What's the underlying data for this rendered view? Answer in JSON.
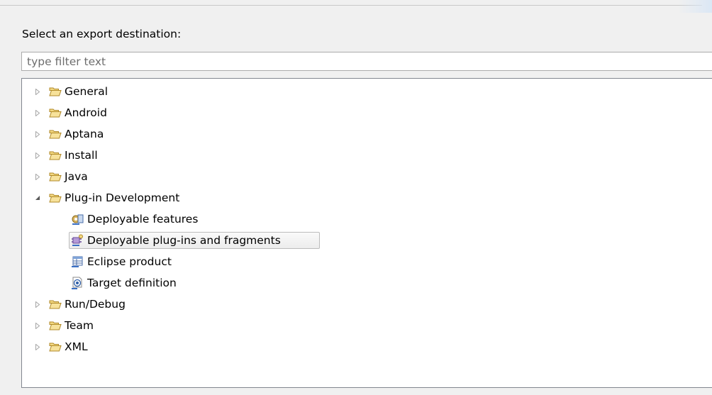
{
  "prompt_label": "Select an export destination:",
  "filter": {
    "value": "",
    "placeholder": "type filter text"
  },
  "tree": {
    "items": [
      {
        "label": "General",
        "icon": "folder-icon",
        "expanded": false
      },
      {
        "label": "Android",
        "icon": "folder-icon",
        "expanded": false
      },
      {
        "label": "Aptana",
        "icon": "folder-icon",
        "expanded": false
      },
      {
        "label": "Install",
        "icon": "folder-icon",
        "expanded": false
      },
      {
        "label": "Java",
        "icon": "folder-icon",
        "expanded": false
      },
      {
        "label": "Plug-in Development",
        "icon": "folder-icon",
        "expanded": true,
        "children": [
          {
            "label": "Deployable features",
            "icon": "feature-export-icon"
          },
          {
            "label": "Deployable plug-ins and fragments",
            "icon": "plugin-export-icon",
            "selected": true
          },
          {
            "label": "Eclipse product",
            "icon": "product-export-icon"
          },
          {
            "label": "Target definition",
            "icon": "target-definition-icon"
          }
        ]
      },
      {
        "label": "Run/Debug",
        "icon": "folder-icon",
        "expanded": false
      },
      {
        "label": "Team",
        "icon": "folder-icon",
        "expanded": false
      },
      {
        "label": "XML",
        "icon": "folder-icon",
        "expanded": false
      }
    ]
  },
  "colors": {
    "folder": "#e8c65a",
    "folder_outline": "#b08a2a",
    "selection_border": "#bcbcbc"
  }
}
